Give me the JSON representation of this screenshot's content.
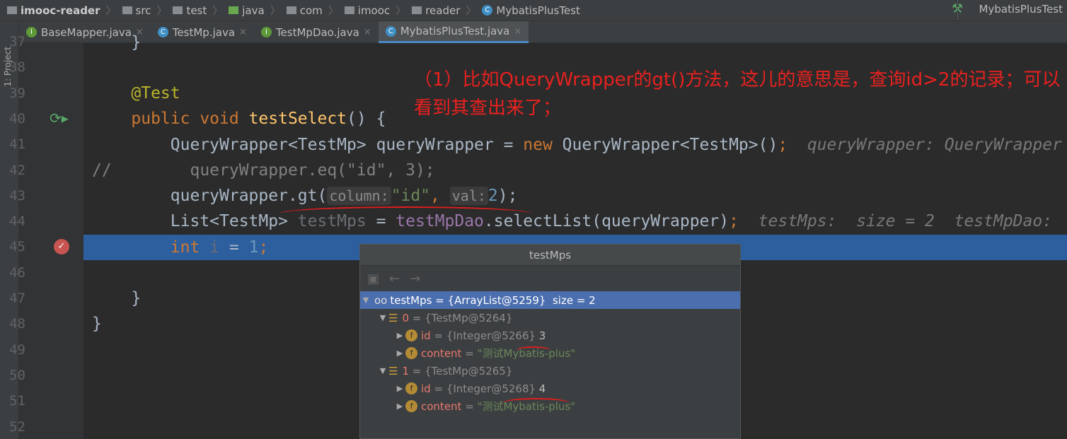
{
  "breadcrumb": [
    "imooc-reader",
    "src",
    "test",
    "java",
    "com",
    "imooc",
    "reader",
    "MybatisPlusTest"
  ],
  "run_config": "MybatisPlusTest",
  "left_tool": "1: Project",
  "tabs": [
    {
      "label": "BaseMapper.java",
      "icon": "interface"
    },
    {
      "label": "TestMp.java",
      "icon": "class"
    },
    {
      "label": "TestMpDao.java",
      "icon": "interface"
    },
    {
      "label": "MybatisPlusTest.java",
      "icon": "class",
      "active": true
    }
  ],
  "close_glyph": "×",
  "line_numbers": [
    "37",
    "38",
    "39",
    "40",
    "41",
    "42",
    "43",
    "44",
    "45",
    "46",
    "47",
    "48",
    "49",
    "50",
    "51",
    "52"
  ],
  "code": {
    "l37": "    }",
    "l39": "@Test",
    "l40a": "public void ",
    "l40b": "testSelect",
    "l40c": "() {",
    "l41a": "QueryWrapper<TestMp> queryWrapper = ",
    "l41b": "new ",
    "l41c": "QueryWrapper<TestMp>()",
    "l41d": ";",
    "l41hint": "  queryWrapper: QueryWrapper",
    "l42": "//        queryWrapper.eq(\"id\", 3);",
    "l43a": "queryWrapper.gt(",
    "l43h1": "column:",
    "l43s": "\"id\"",
    "l43c": ", ",
    "l43h2": "val:",
    "l43n": "2",
    "l43e": ");",
    "l44a": "List<TestMp> ",
    "l44b": "testMps",
    "l44c": " = ",
    "l44d": "testMpDao",
    "l44e": ".selectList(queryWrapper)",
    "l44f": ";",
    "l44hint": "  testMps:  size = 2  testMpDao:",
    "l45a": "int ",
    "l45b": "i",
    "l45c": " = ",
    "l45d": "1",
    "l45e": ";",
    "l47": "}",
    "l48": "}"
  },
  "annotation": "（1）比如QueryWrapper的gt()方法，这儿的意思是，查询id>2的记录；可以看到其查出来了；",
  "popup": {
    "title": "testMps",
    "root": {
      "name": "testMps",
      "value": " = {ArrayList@5259}  size = 2"
    },
    "items": [
      {
        "index": "0",
        "ref": " = {TestMp@5264}",
        "fields": [
          {
            "name": "id",
            "ref": " = {Integer@5266} ",
            "value": "3"
          },
          {
            "name": "content",
            "ref": " = ",
            "value": "\"测试Mybatis-plus\""
          }
        ]
      },
      {
        "index": "1",
        "ref": " = {TestMp@5265}",
        "fields": [
          {
            "name": "id",
            "ref": " = {Integer@5268} ",
            "value": "4"
          },
          {
            "name": "content",
            "ref": " = ",
            "value": "\"测试Mybatis-plus\""
          }
        ]
      }
    ]
  },
  "colors": {
    "current_line": "#2d5e9e",
    "annotation": "#e8211f",
    "selection": "#4b6eaf"
  }
}
